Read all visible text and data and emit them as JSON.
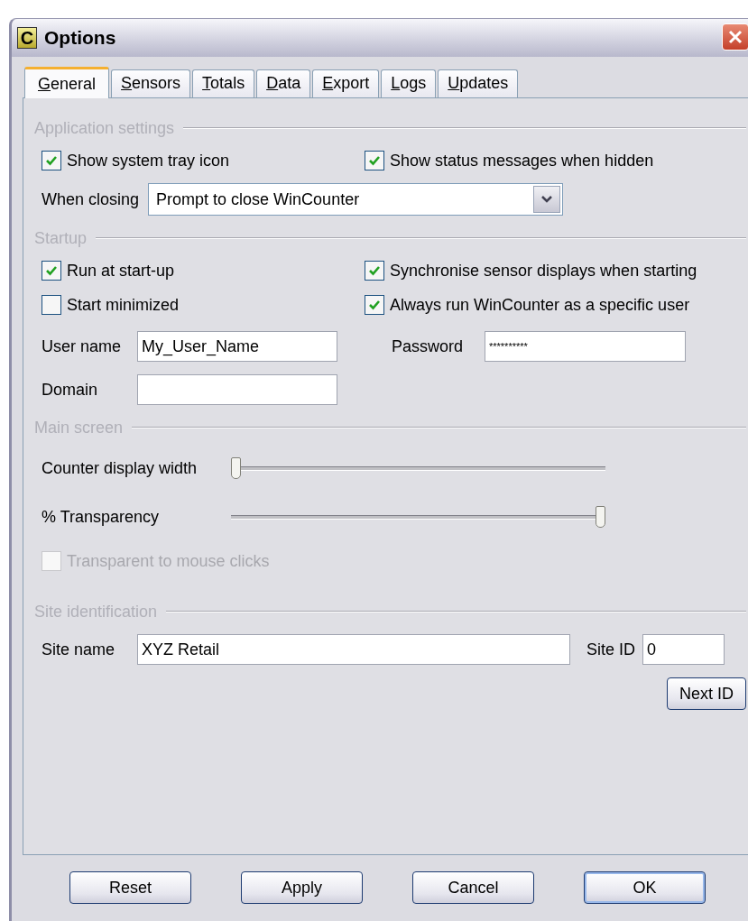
{
  "window": {
    "title": "Options",
    "icon_letter": "C"
  },
  "tabs": [
    {
      "label": "General",
      "selected": true
    },
    {
      "label": "Sensors",
      "selected": false
    },
    {
      "label": "Totals",
      "selected": false
    },
    {
      "label": "Data",
      "selected": false
    },
    {
      "label": "Export",
      "selected": false
    },
    {
      "label": "Logs",
      "selected": false
    },
    {
      "label": "Updates",
      "selected": false
    }
  ],
  "application_settings": {
    "title": "Application settings",
    "checkboxes": [
      {
        "label": "Show system tray icon",
        "checked": true
      },
      {
        "label": "Show status messages when hidden",
        "checked": true
      }
    ],
    "when_closing": {
      "label": "When closing",
      "value": "Prompt to close WinCounter"
    }
  },
  "startup": {
    "title": "Startup",
    "checkboxes": [
      {
        "label": "Run at start-up",
        "checked": true
      },
      {
        "label": "Synchronise sensor displays when starting",
        "checked": true
      },
      {
        "label": "Start minimized",
        "checked": false
      },
      {
        "label": "Always run WinCounter as a specific user",
        "checked": true
      }
    ],
    "user_name": {
      "label": "User name",
      "value": "My_User_Name"
    },
    "password": {
      "label": "Password",
      "value": "**********"
    },
    "domain": {
      "label": "Domain"
    }
  },
  "main_screen": {
    "title": "Main screen",
    "sliders": [
      {
        "label": "Counter display width",
        "level": 0
      },
      {
        "label": "% Transparency",
        "level": 1
      }
    ],
    "transparent_clicks": {
      "label": "Transparent to mouse clicks",
      "checked": false,
      "disabled": true
    }
  },
  "site_identification": {
    "title": "Site identification",
    "site_name": {
      "label": "Site name",
      "value": "XYZ Retail"
    },
    "site_id": {
      "label": "Site ID",
      "value": "0"
    },
    "next_id_button": {
      "label": "Next ID"
    }
  },
  "buttons": [
    {
      "label": "Reset",
      "default": false
    },
    {
      "label": "Apply",
      "default": false
    },
    {
      "label": "Cancel",
      "default": false
    },
    {
      "label": "OK",
      "default": true
    }
  ]
}
